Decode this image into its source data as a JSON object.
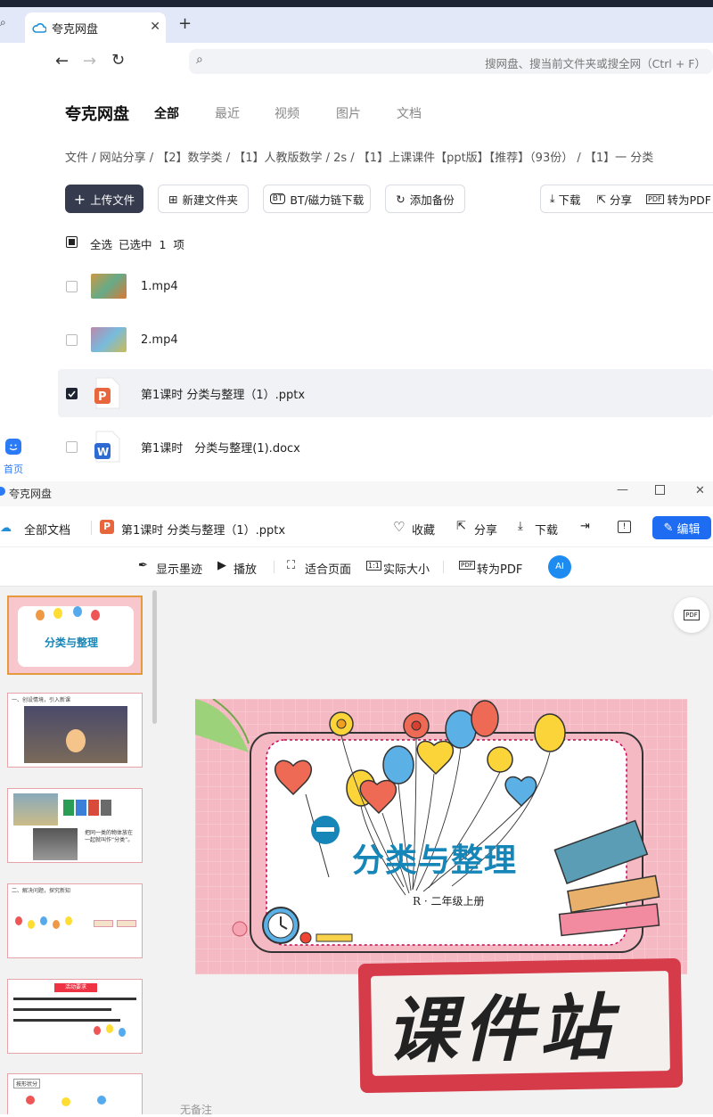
{
  "browser": {
    "tab_title": "夸克网盘",
    "search_placeholder": "搜网盘、搜当前文件夹或搜全网（Ctrl + F）"
  },
  "sidebar": {
    "home_label": "首页"
  },
  "drive": {
    "brand": "夸克网盘",
    "tabs": [
      "全部",
      "最近",
      "视频",
      "图片",
      "文档"
    ],
    "breadcrumb": "文件 / 网站分享 / 【2】数学类 / 【1】人教版数学 / 2s / 【1】上课课件【ppt版】【推荐】（93份） / 【1】一 分类",
    "toolbar": {
      "upload": "上传文件",
      "new_folder": "新建文件夹",
      "bt": "BT/磁力链下载",
      "backup": "添加备份",
      "download": "下载",
      "share": "分享",
      "to_pdf": "转为PDF"
    },
    "select_all": "全选",
    "selected_info": "已选中  1  项",
    "files": [
      {
        "name": "1.mp4",
        "checked": false
      },
      {
        "name": "2.mp4",
        "checked": false
      },
      {
        "name": "第1课时 分类与整理（1）.pptx",
        "checked": true
      },
      {
        "name": "第1课时　分类与整理(1).docx",
        "checked": false
      }
    ]
  },
  "viewer": {
    "window_title": "夸克网盘",
    "all_docs": "全部文档",
    "file_title": "第1课时 分类与整理（1）.pptx",
    "actions": {
      "collect": "收藏",
      "share": "分享",
      "download": "下载",
      "edit": "编辑"
    },
    "tools": {
      "ink": "显示墨迹",
      "play": "播放",
      "fit": "适合页面",
      "actual": "实际大小",
      "pdf": "转为PDF"
    },
    "no_notes": "无备注",
    "slide": {
      "title": "分类与整理",
      "subtitle": "R · 二年级上册",
      "watermark": "课件站"
    },
    "thumbs": [
      {
        "text": "分类与整理"
      },
      {
        "text": "一、创设情境，引入新课"
      },
      {
        "text": "把同一类的物体放在一起就叫作“分类”。"
      },
      {
        "text": "二、解决问题，探究新知"
      },
      {
        "text": "活动要求"
      },
      {
        "text": "按形状分"
      }
    ]
  },
  "colors": {
    "accent": "#1e6cf1",
    "dark_button": "#363b4e",
    "slide_title": "#1686b8",
    "watermark_red": "#d63b4a"
  }
}
